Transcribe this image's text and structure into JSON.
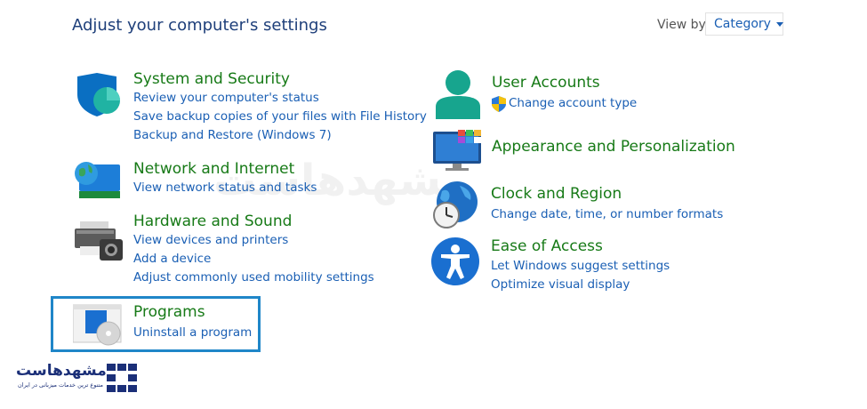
{
  "header": {
    "title": "Adjust your computer's settings",
    "view_by_label": "View by:",
    "view_by_value": "Category"
  },
  "categories": {
    "system_security": {
      "title": "System and Security",
      "links": [
        "Review your computer's status",
        "Save backup copies of your files with File History",
        "Backup and Restore (Windows 7)"
      ]
    },
    "network_internet": {
      "title": "Network and Internet",
      "links": [
        "View network status and tasks"
      ]
    },
    "hardware_sound": {
      "title": "Hardware and Sound",
      "links": [
        "View devices and printers",
        "Add a device",
        "Adjust commonly used mobility settings"
      ]
    },
    "programs": {
      "title": "Programs",
      "links": [
        "Uninstall a program"
      ]
    },
    "user_accounts": {
      "title": "User Accounts",
      "links": [
        "Change account type"
      ]
    },
    "appearance": {
      "title": "Appearance and Personalization"
    },
    "clock_region": {
      "title": "Clock and Region",
      "links": [
        "Change date, time, or number formats"
      ]
    },
    "ease_access": {
      "title": "Ease of Access",
      "links": [
        "Let Windows suggest settings",
        "Optimize visual display"
      ]
    }
  },
  "brand": {
    "name": "مشهدهاست",
    "tagline": "متنوع ترین خدمات میزبانی در ایران"
  },
  "colors": {
    "title_green": "#177a17",
    "link_blue": "#1a5fb4",
    "highlight_blue": "#1f86c8"
  }
}
